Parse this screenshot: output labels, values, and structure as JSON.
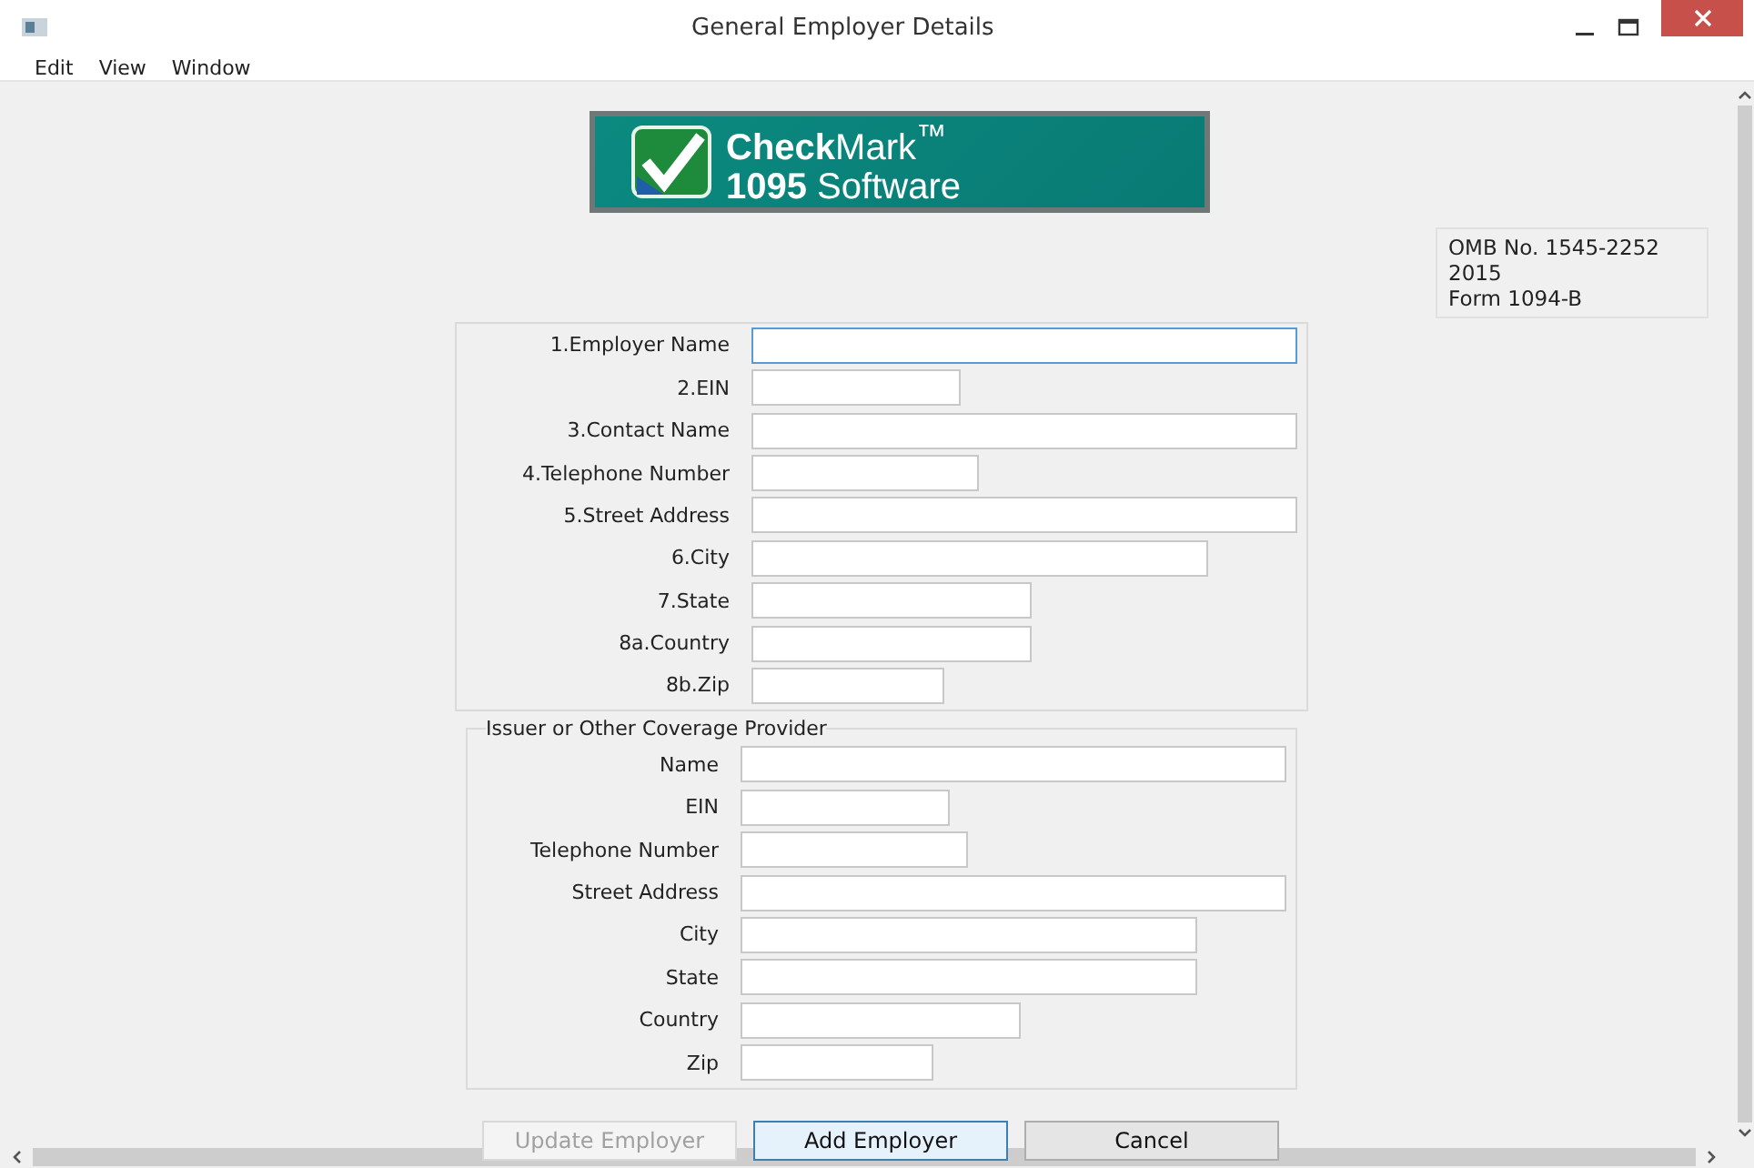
{
  "window": {
    "title": "General Employer Details"
  },
  "menu": [
    "Edit",
    "View",
    "Window"
  ],
  "logo": {
    "line_1": "**Check**Mark$^{™}$",
    "line_2": "**1095** Software"
  },
  "form_info": [
    "OMB No. 1545-2252",
    "2015",
    "Form 1094-B"
  ],
  "employer": {
    "fields": [
      {
        "label": "1.Employer Name",
        "focused": true
      },
      {
        "label": "2.EIN",
        "focused": false
      },
      {
        "label": "3.Contact Name",
        "focused": false
      },
      {
        "label": "4.Telephone Number",
        "focused": false
      },
      {
        "label": "5.Street Address",
        "focused": false
      },
      {
        "label": "6.City",
        "focused": false
      },
      {
        "label": "7.State",
        "focused": false
      },
      {
        "label": "8a.Country",
        "focused": false
      },
      {
        "label": "8b.Zip",
        "focused": false
      }
    ]
  },
  "issuer": {
    "title": "Issuer or Other Coverage Provider",
    "fields": [
      {
        "label": "Name",
        "focused": false
      },
      {
        "label": "EIN",
        "focused": false
      },
      {
        "label": "Telephone Number",
        "focused": false
      },
      {
        "label": "Street Address",
        "focused": false
      },
      {
        "label": "City",
        "focused": false
      },
      {
        "label": "State",
        "focused": false
      },
      {
        "label": "Country",
        "focused": false
      },
      {
        "label": "Zip",
        "focused": false
      }
    ]
  },
  "buttons": [
    {
      "label": "Update Employer",
      "disabled": true,
      "focused": false
    },
    {
      "label": "Add Employer",
      "disabled": false,
      "focused": true
    },
    {
      "label": "Cancel",
      "disabled": false,
      "focused": false
    }
  ]
}
